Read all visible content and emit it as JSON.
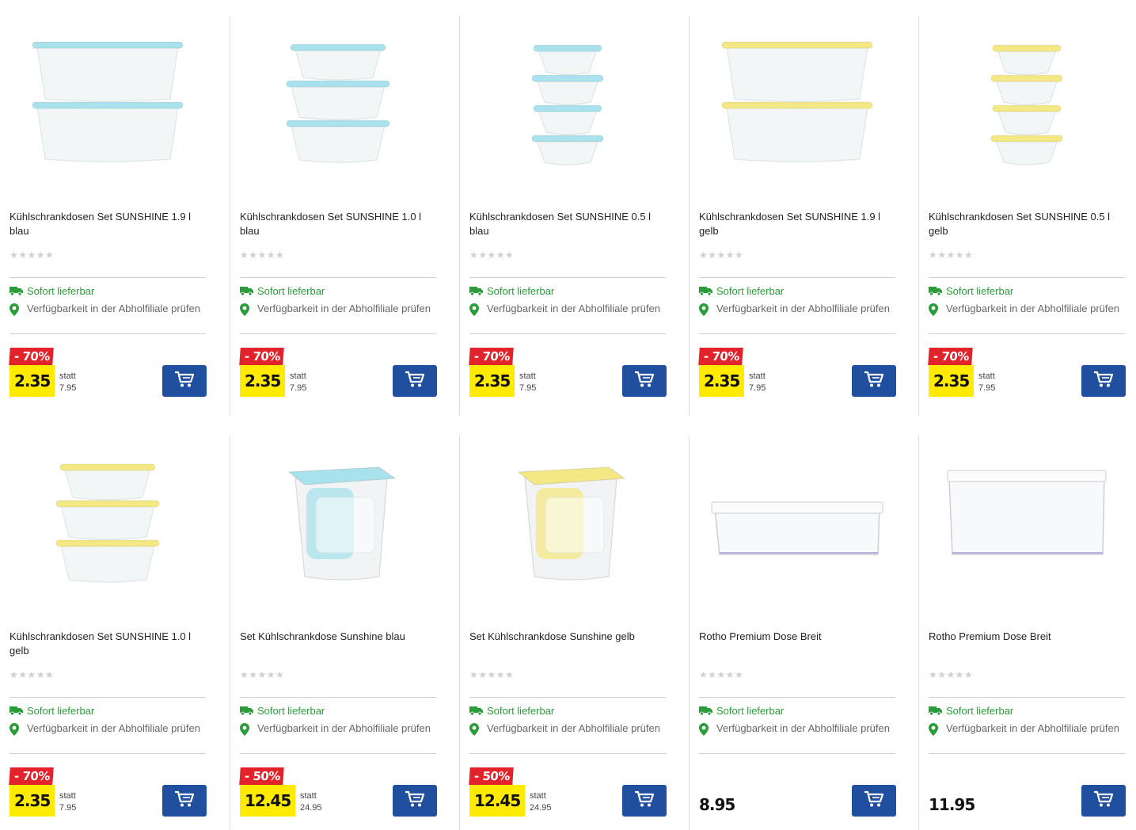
{
  "colors": {
    "discount_bg": "#e3232b",
    "price_bg": "#ffea00",
    "cart_button": "#1f4f9e",
    "availability_green": "#2a9d3a",
    "lid_blue": "#a9e1ec",
    "lid_yellow": "#f3e884"
  },
  "products": [
    {
      "title": "Kühlschrankdosen Set SUNSHINE 1.9 l blau",
      "rating_stars": "★★★★★",
      "rating_value": 0,
      "shipping": "Sofort lieferbar",
      "store_check": "Verfügbarkeit in der Abholfiliale prüfen",
      "discount": "- 70%",
      "price": "2.35",
      "statt_label": "statt",
      "old_price": "7.95",
      "image": "two-stacked-boxes-blue",
      "icons": {
        "shipping": "truck-icon",
        "store": "location-pin-icon",
        "cart": "cart-icon"
      }
    },
    {
      "title": "Kühlschrankdosen Set SUNSHINE 1.0 l blau",
      "rating_stars": "★★★★★",
      "rating_value": 0,
      "shipping": "Sofort lieferbar",
      "store_check": "Verfügbarkeit in der Abholfiliale prüfen",
      "discount": "- 70%",
      "price": "2.35",
      "statt_label": "statt",
      "old_price": "7.95",
      "image": "three-stacked-boxes-blue",
      "icons": {
        "shipping": "truck-icon",
        "store": "location-pin-icon",
        "cart": "cart-icon"
      }
    },
    {
      "title": "Kühlschrankdosen Set SUNSHINE 0.5 l blau",
      "rating_stars": "★★★★★",
      "rating_value": 0,
      "shipping": "Sofort lieferbar",
      "store_check": "Verfügbarkeit in der Abholfiliale prüfen",
      "discount": "- 70%",
      "price": "2.35",
      "statt_label": "statt",
      "old_price": "7.95",
      "image": "four-stacked-boxes-blue",
      "icons": {
        "shipping": "truck-icon",
        "store": "location-pin-icon",
        "cart": "cart-icon"
      }
    },
    {
      "title": "Kühlschrankdosen Set SUNSHINE 1.9 l gelb",
      "rating_stars": "★★★★★",
      "rating_value": 0,
      "shipping": "Sofort lieferbar",
      "store_check": "Verfügbarkeit in der Abholfiliale prüfen",
      "discount": "- 70%",
      "price": "2.35",
      "statt_label": "statt",
      "old_price": "7.95",
      "image": "two-stacked-boxes-yellow",
      "icons": {
        "shipping": "truck-icon",
        "store": "location-pin-icon",
        "cart": "cart-icon"
      }
    },
    {
      "title": "Kühlschrankdosen Set SUNSHINE 0.5 l gelb",
      "rating_stars": "★★★★★",
      "rating_value": 0,
      "shipping": "Sofort lieferbar",
      "store_check": "Verfügbarkeit in der Abholfiliale prüfen",
      "discount": "- 70%",
      "price": "2.35",
      "statt_label": "statt",
      "old_price": "7.95",
      "image": "four-stacked-boxes-yellow",
      "icons": {
        "shipping": "truck-icon",
        "store": "location-pin-icon",
        "cart": "cart-icon"
      }
    },
    {
      "title": "Kühlschrankdosen Set SUNSHINE 1.0 l gelb",
      "rating_stars": "★★★★★",
      "rating_value": 0,
      "shipping": "Sofort lieferbar",
      "store_check": "Verfügbarkeit in der Abholfiliale prüfen",
      "discount": "- 70%",
      "price": "2.35",
      "statt_label": "statt",
      "old_price": "7.95",
      "image": "three-stacked-boxes-yellow",
      "icons": {
        "shipping": "truck-icon",
        "store": "location-pin-icon",
        "cart": "cart-icon"
      }
    },
    {
      "title": "Set Kühlschrankdose Sunshine blau",
      "rating_stars": "★★★★★",
      "rating_value": 0,
      "shipping": "Sofort lieferbar",
      "store_check": "Verfügbarkeit in der Abholfiliale prüfen",
      "discount": "- 50%",
      "price": "12.45",
      "statt_label": "statt",
      "old_price": "24.95",
      "image": "tall-box-nested-blue",
      "icons": {
        "shipping": "truck-icon",
        "store": "location-pin-icon",
        "cart": "cart-icon"
      }
    },
    {
      "title": "Set Kühlschrankdose Sunshine gelb",
      "rating_stars": "★★★★★",
      "rating_value": 0,
      "shipping": "Sofort lieferbar",
      "store_check": "Verfügbarkeit in der Abholfiliale prüfen",
      "discount": "- 50%",
      "price": "12.45",
      "statt_label": "statt",
      "old_price": "24.95",
      "image": "tall-box-nested-yellow",
      "icons": {
        "shipping": "truck-icon",
        "store": "location-pin-icon",
        "cart": "cart-icon"
      }
    },
    {
      "title": "Rotho Premium Dose Breit",
      "rating_stars": "★★★★★",
      "rating_value": 0,
      "shipping": "Sofort lieferbar",
      "store_check": "Verfügbarkeit in der Abholfiliale prüfen",
      "discount": "",
      "price": "8.95",
      "statt_label": "",
      "old_price": "",
      "image": "flat-clear-box-white-lid",
      "icons": {
        "shipping": "truck-icon",
        "store": "location-pin-icon",
        "cart": "cart-icon"
      }
    },
    {
      "title": "Rotho Premium Dose Breit",
      "rating_stars": "★★★★★",
      "rating_value": 0,
      "shipping": "Sofort lieferbar",
      "store_check": "Verfügbarkeit in der Abholfiliale prüfen",
      "discount": "",
      "price": "11.95",
      "statt_label": "",
      "old_price": "",
      "image": "deep-clear-box-white-lid",
      "icons": {
        "shipping": "truck-icon",
        "store": "location-pin-icon",
        "cart": "cart-icon"
      }
    }
  ]
}
